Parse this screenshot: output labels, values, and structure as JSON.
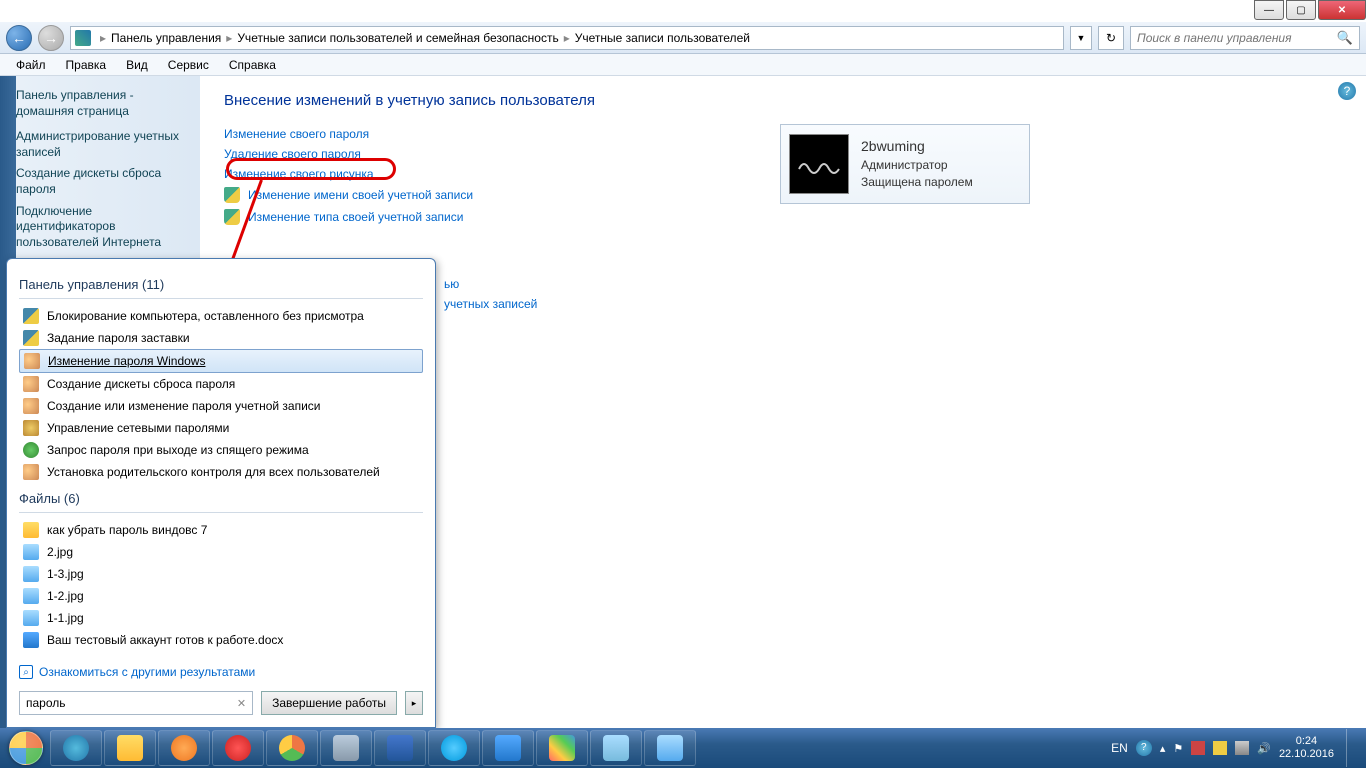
{
  "titlebar": {
    "min": "—",
    "max": "▢",
    "close": "✕"
  },
  "nav": {
    "crumbs": [
      "Панель управления",
      "Учетные записи пользователей и семейная безопасность",
      "Учетные записи пользователей"
    ],
    "search_placeholder": "Поиск в панели управления"
  },
  "menu": [
    "Файл",
    "Правка",
    "Вид",
    "Сервис",
    "Справка"
  ],
  "sidebar": {
    "header": "Панель управления - домашняя страница",
    "items": [
      "Администрирование учетных записей",
      "Создание дискеты сброса пароля",
      "Подключение идентификаторов пользователей Интернета"
    ]
  },
  "main": {
    "heading": "Внесение изменений в учетную запись пользователя",
    "tasks": [
      {
        "label": "Изменение своего пароля",
        "shield": false
      },
      {
        "label": "Удаление своего пароля",
        "shield": false
      },
      {
        "label": "Изменение своего рисунка",
        "shield": false
      },
      {
        "label": "Изменение имени своей учетной записи",
        "shield": true
      },
      {
        "label": "Изменение типа своей учетной записи",
        "shield": true
      },
      {
        "label": "ью",
        "shield": true,
        "partial": true
      },
      {
        "label": "учетных записей",
        "shield": true,
        "partial": true
      }
    ],
    "user": {
      "name": "2bwuming",
      "role": "Администратор",
      "status": "Защищена паролем"
    }
  },
  "startmenu": {
    "sec1_title": "Панель управления (11)",
    "sec1": [
      {
        "label": "Блокирование компьютера, оставленного без присмотра",
        "ico": "shield"
      },
      {
        "label": "Задание пароля заставки",
        "ico": "shield"
      },
      {
        "label": "Изменение пароля Windows",
        "ico": "users",
        "selected": true,
        "underline": true
      },
      {
        "label": "Создание дискеты сброса пароля",
        "ico": "users"
      },
      {
        "label": "Создание или изменение пароля учетной записи",
        "ico": "users"
      },
      {
        "label": "Управление сетевыми паролями",
        "ico": "net"
      },
      {
        "label": "Запрос пароля при выходе из спящего режима",
        "ico": "green"
      },
      {
        "label": "Установка родительского контроля для всех пользователей",
        "ico": "users"
      }
    ],
    "sec2_title": "Файлы (6)",
    "sec2": [
      {
        "label": "как убрать пароль виндовс 7",
        "ico": "folder"
      },
      {
        "label": "2.jpg",
        "ico": "img"
      },
      {
        "label": "1-3.jpg",
        "ico": "img"
      },
      {
        "label": "1-2.jpg",
        "ico": "img"
      },
      {
        "label": "1-1.jpg",
        "ico": "img"
      },
      {
        "label": "Ваш тестовый аккаунт готов к работе.docx",
        "ico": "doc"
      }
    ],
    "more_results": "Ознакомиться с другими результатами",
    "search_value": "пароль",
    "shutdown": "Завершение работы"
  },
  "taskbar": {
    "apps": [
      "ie",
      "explorer",
      "wmp",
      "opera",
      "chrome",
      "taskview",
      "save",
      "skype",
      "word",
      "paint",
      "folder",
      "pictures"
    ]
  },
  "tray": {
    "lang": "EN",
    "time": "0:24",
    "date": "22.10.2016"
  }
}
